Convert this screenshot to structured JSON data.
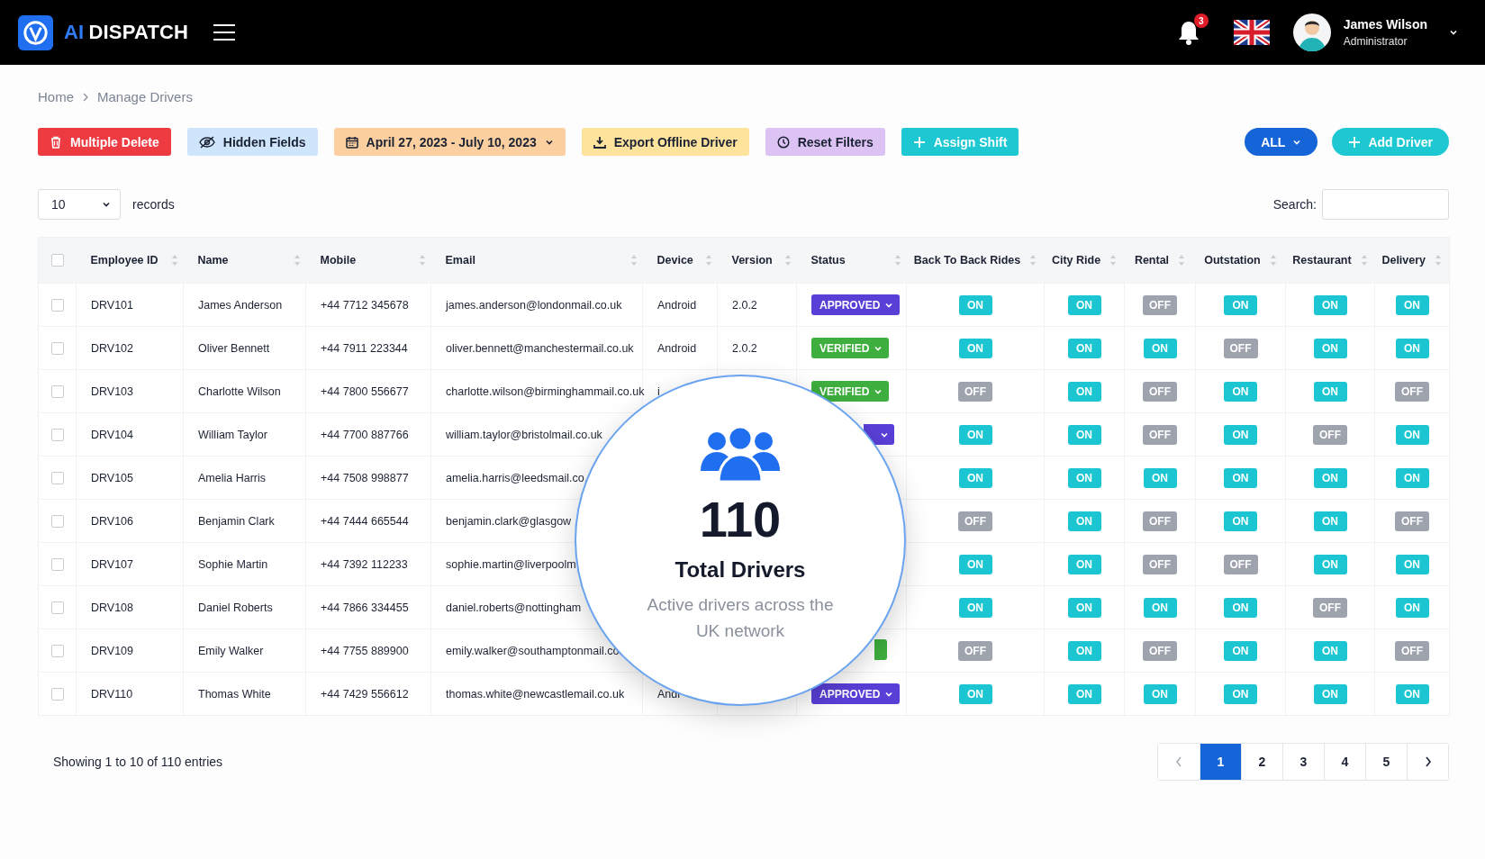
{
  "header": {
    "brand": {
      "accent": "AI",
      "name": "DISPATCH"
    },
    "notifications": "3",
    "user": {
      "name": "James Wilson",
      "role": "Administrator"
    }
  },
  "breadcrumb": [
    {
      "label": "Home"
    },
    {
      "label": "Manage Drivers"
    }
  ],
  "toolbar": [
    {
      "kind": "delete",
      "label": "Multiple Delete"
    },
    {
      "kind": "hidden",
      "label": "Hidden Fields"
    },
    {
      "kind": "date",
      "label": "April 27, 2023 - July 10, 2023"
    },
    {
      "kind": "export",
      "label": "Export Offline Driver"
    },
    {
      "kind": "reset",
      "label": "Reset Filters"
    },
    {
      "kind": "shift",
      "label": "Assign Shift"
    }
  ],
  "filter": {
    "label": "ALL"
  },
  "add_button": {
    "label": "Add Driver"
  },
  "page_size": {
    "value": "10",
    "label": "records"
  },
  "search": {
    "label": "Search:"
  },
  "table": {
    "all_checked": false,
    "columns": [
      "Employee ID",
      "Name",
      "Mobile",
      "Email",
      "Device",
      "Version",
      "Status",
      "Back To Back Rides",
      "City Ride",
      "Rental",
      "Outstation",
      "Restaurant",
      "Delivery"
    ],
    "rows": [
      {
        "checked": false,
        "id": "DRV101",
        "name": "James Anderson",
        "mobile": "+44 7712 345678",
        "email": "james.anderson@londonmail.co.uk",
        "device": "Android",
        "version": "2.0.2",
        "status": {
          "kind": "approved",
          "label": "APPROVED"
        },
        "services": [
          {
            "label": "ON",
            "on": true
          },
          {
            "label": "ON",
            "on": true
          },
          {
            "label": "OFF",
            "on": false
          },
          {
            "label": "ON",
            "on": true
          },
          {
            "label": "ON",
            "on": true
          },
          {
            "label": "ON",
            "on": true
          }
        ]
      },
      {
        "checked": false,
        "id": "DRV102",
        "name": "Oliver Bennett",
        "mobile": "+44 7911 223344",
        "email": "oliver.bennett@manchestermail.co.uk",
        "device": "Android",
        "version": "2.0.2",
        "status": {
          "kind": "verified",
          "label": "VERIFIED"
        },
        "services": [
          {
            "label": "ON",
            "on": true
          },
          {
            "label": "ON",
            "on": true
          },
          {
            "label": "ON",
            "on": true
          },
          {
            "label": "OFF",
            "on": false
          },
          {
            "label": "ON",
            "on": true
          },
          {
            "label": "ON",
            "on": true
          }
        ]
      },
      {
        "checked": false,
        "id": "DRV103",
        "name": "Charlotte Wilson",
        "mobile": "+44 7800 556677",
        "email": "charlotte.wilson@birminghammail.co.uk",
        "device": "i",
        "status": {
          "kind": "verified",
          "label": "VERIFIED"
        },
        "services": [
          {
            "label": "OFF",
            "on": false
          },
          {
            "label": "ON",
            "on": true
          },
          {
            "label": "OFF",
            "on": false
          },
          {
            "label": "ON",
            "on": true
          },
          {
            "label": "ON",
            "on": true
          },
          {
            "label": "OFF",
            "on": false
          }
        ]
      },
      {
        "checked": false,
        "id": "DRV104",
        "name": "William Taylor",
        "mobile": "+44 7700 887766",
        "email": "william.taylor@bristolmail.co.uk",
        "status": {
          "kind": "approved"
        },
        "services": [
          {
            "label": "ON",
            "on": true
          },
          {
            "label": "ON",
            "on": true
          },
          {
            "label": "OFF",
            "on": false
          },
          {
            "label": "ON",
            "on": true
          },
          {
            "label": "OFF",
            "on": false
          },
          {
            "label": "ON",
            "on": true
          }
        ]
      },
      {
        "checked": false,
        "id": "DRV105",
        "name": "Amelia Harris",
        "mobile": "+44 7508 998877",
        "email": "amelia.harris@leedsmail.co.",
        "services": [
          {
            "label": "ON",
            "on": true
          },
          {
            "label": "ON",
            "on": true
          },
          {
            "label": "ON",
            "on": true
          },
          {
            "label": "ON",
            "on": true
          },
          {
            "label": "ON",
            "on": true
          },
          {
            "label": "ON",
            "on": true
          }
        ]
      },
      {
        "checked": false,
        "id": "DRV106",
        "name": "Benjamin Clark",
        "mobile": "+44 7444 665544",
        "email": "benjamin.clark@glasgow",
        "services": [
          {
            "label": "OFF",
            "on": false
          },
          {
            "label": "ON",
            "on": true
          },
          {
            "label": "OFF",
            "on": false
          },
          {
            "label": "ON",
            "on": true
          },
          {
            "label": "ON",
            "on": true
          },
          {
            "label": "OFF",
            "on": false
          }
        ]
      },
      {
        "checked": false,
        "id": "DRV107",
        "name": "Sophie Martin",
        "mobile": "+44 7392 112233",
        "email": "sophie.martin@liverpoolm",
        "services": [
          {
            "label": "ON",
            "on": true
          },
          {
            "label": "ON",
            "on": true
          },
          {
            "label": "OFF",
            "on": false
          },
          {
            "label": "OFF",
            "on": false
          },
          {
            "label": "ON",
            "on": true
          },
          {
            "label": "ON",
            "on": true
          }
        ]
      },
      {
        "checked": false,
        "id": "DRV108",
        "name": "Daniel Roberts",
        "mobile": "+44 7866 334455",
        "email": "daniel.roberts@nottingham",
        "services": [
          {
            "label": "ON",
            "on": true
          },
          {
            "label": "ON",
            "on": true
          },
          {
            "label": "ON",
            "on": true
          },
          {
            "label": "ON",
            "on": true
          },
          {
            "label": "OFF",
            "on": false
          },
          {
            "label": "ON",
            "on": true
          }
        ]
      },
      {
        "checked": false,
        "id": "DRV109",
        "name": "Emily Walker",
        "mobile": "+44 7755 889900",
        "email": "emily.walker@southamptonmail.co.",
        "status": {
          "kind": "verified"
        },
        "services": [
          {
            "label": "OFF",
            "on": false
          },
          {
            "label": "ON",
            "on": true
          },
          {
            "label": "OFF",
            "on": false
          },
          {
            "label": "ON",
            "on": true
          },
          {
            "label": "ON",
            "on": true
          },
          {
            "label": "OFF",
            "on": false
          }
        ]
      },
      {
        "checked": false,
        "id": "DRV110",
        "name": "Thomas White",
        "mobile": "+44 7429 556612",
        "email": "thomas.white@newcastlemail.co.uk",
        "device": "Andr",
        "status": {
          "kind": "approved",
          "label": "APPROVED"
        },
        "services": [
          {
            "label": "ON",
            "on": true
          },
          {
            "label": "ON",
            "on": true
          },
          {
            "label": "ON",
            "on": true
          },
          {
            "label": "ON",
            "on": true
          },
          {
            "label": "ON",
            "on": true
          },
          {
            "label": "ON",
            "on": true
          }
        ]
      }
    ]
  },
  "highlight": {
    "value": "110",
    "title": "Total Drivers",
    "text": "Active drivers across the UK network"
  },
  "footer": {
    "info": "Showing 1 to 10 of 110 entries"
  },
  "pagination": [
    {
      "label": "1",
      "selected": true
    },
    {
      "label": "2",
      "selected": false
    },
    {
      "label": "3",
      "selected": false
    },
    {
      "label": "4",
      "selected": false
    },
    {
      "label": "5",
      "selected": false
    }
  ]
}
